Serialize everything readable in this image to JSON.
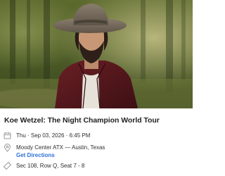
{
  "event": {
    "title": "Koe Wetzel: The Night Champion World Tour",
    "datetime": "Thu · Sep 03, 2026 · 6:45 PM",
    "venue": "Moody Center ATX — Austin, Texas",
    "directions_label": "Get Directions",
    "seat": "Sec 108, Row Q, Seat 7 - 8"
  },
  "icons": {
    "datetime": "calendar-icon",
    "venue": "location-pin-icon",
    "seat": "ticket-icon"
  },
  "colors": {
    "link": "#2f6fd6",
    "title": "#222222",
    "text": "#2f2f2f",
    "icon": "#9a9a9a"
  }
}
